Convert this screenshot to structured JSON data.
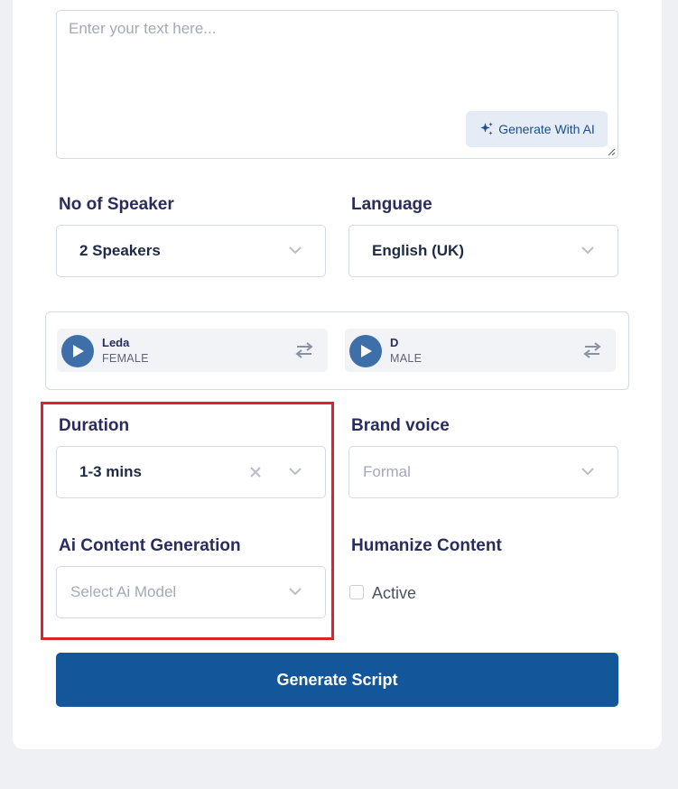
{
  "script_input": {
    "placeholder": "Enter your text here...",
    "generate_ai_label": "Generate With AI"
  },
  "speakers": {
    "label": "No of Speaker",
    "value": "2 Speakers"
  },
  "language": {
    "label": "Language",
    "value": "English (UK)"
  },
  "voices": [
    {
      "name": "Leda",
      "gender": "FEMALE"
    },
    {
      "name": "D",
      "gender": "MALE"
    }
  ],
  "duration": {
    "label": "Duration",
    "value": "1-3 mins"
  },
  "brand_voice": {
    "label": "Brand voice",
    "value": "Formal"
  },
  "ai_content": {
    "label": "Ai Content Generation",
    "placeholder": "Select Ai Model"
  },
  "humanize": {
    "label": "Humanize Content",
    "checkbox_label": "Active",
    "checked": false
  },
  "generate_script_label": "Generate Script",
  "colors": {
    "primary": "#13569a",
    "highlight": "#e0202a",
    "voice_play": "#3e6fa8"
  }
}
